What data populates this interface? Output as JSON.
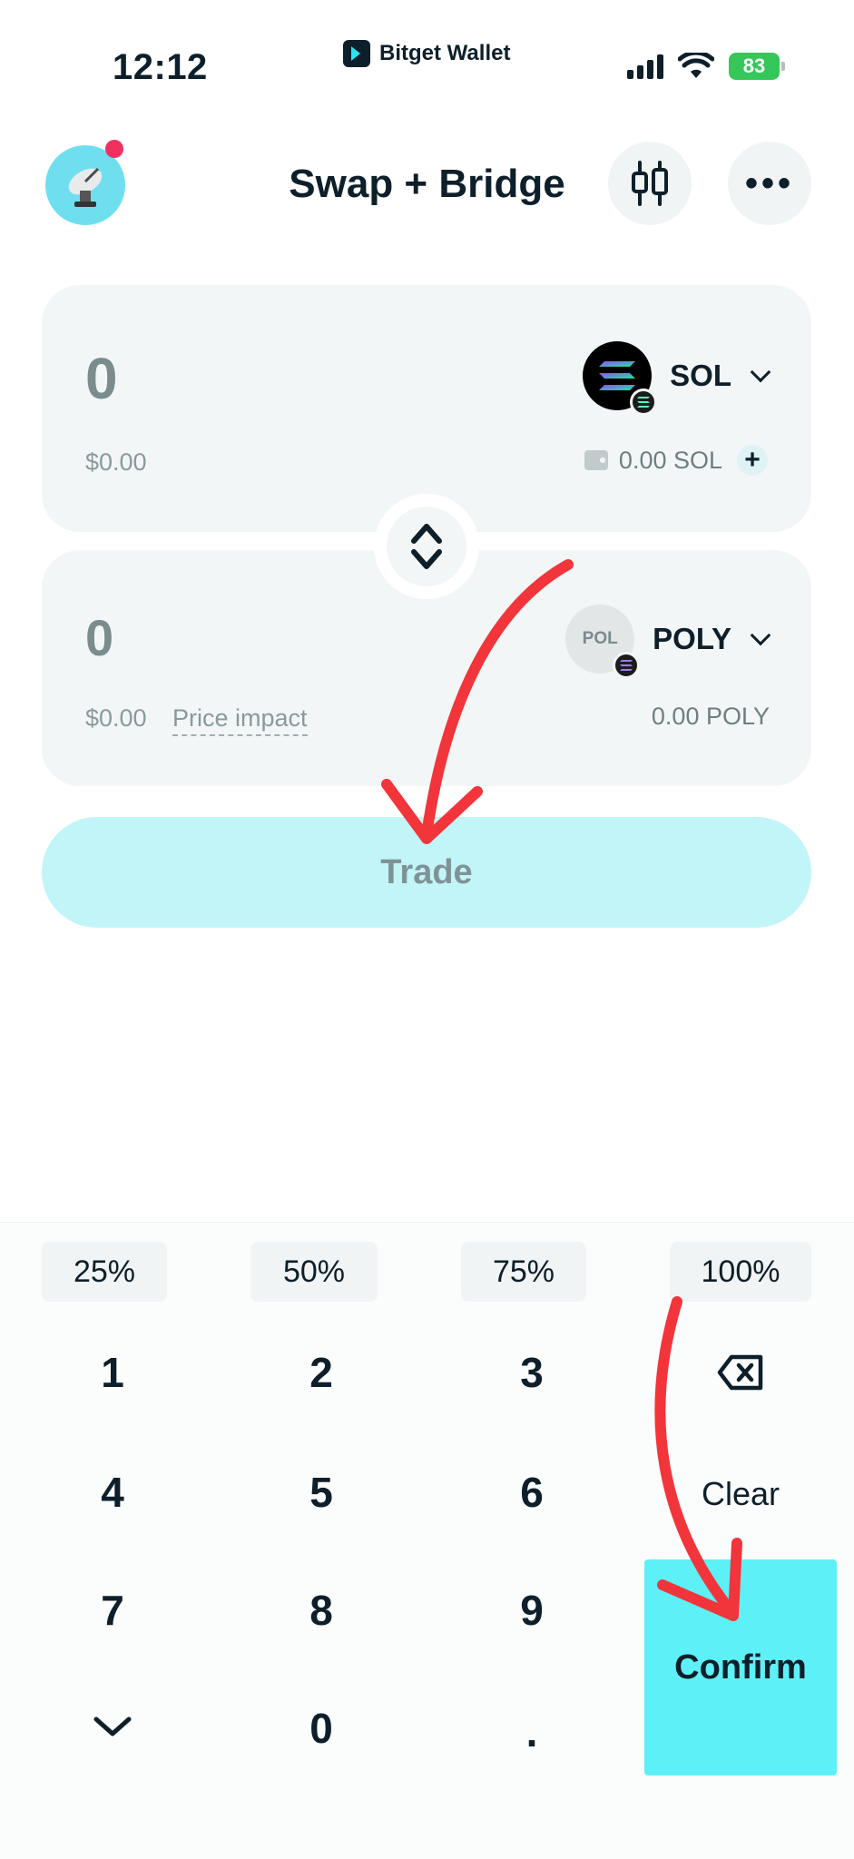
{
  "status_bar": {
    "time": "12:12",
    "brand": "Bitget Wallet",
    "battery": "83"
  },
  "header": {
    "title": "Swap + Bridge",
    "more_label": "•••"
  },
  "from": {
    "amount": "0",
    "usd_value": "$0.00",
    "token_symbol": "SOL",
    "balance": "0.00 SOL",
    "plus_label": "+"
  },
  "to": {
    "amount": "0",
    "usd_value": "$0.00",
    "price_impact_label": "Price impact",
    "token_symbol": "POLY",
    "token_icon_text": "POL",
    "balance": "0.00 POLY"
  },
  "trade_button": "Trade",
  "percent_buttons": [
    "25%",
    "50%",
    "75%",
    "100%"
  ],
  "keypad": {
    "k1": "1",
    "k2": "2",
    "k3": "3",
    "k4": "4",
    "k5": "5",
    "k6": "6",
    "k7": "7",
    "k8": "8",
    "k9": "9",
    "k0": "0",
    "dot": ".",
    "clear": "Clear",
    "confirm": "Confirm"
  },
  "colors": {
    "accent": "#5ef0f7",
    "trade_disabled": "#c2f5f8",
    "annotation_arrow": "#f2353a",
    "notification_dot": "#f0315f"
  }
}
